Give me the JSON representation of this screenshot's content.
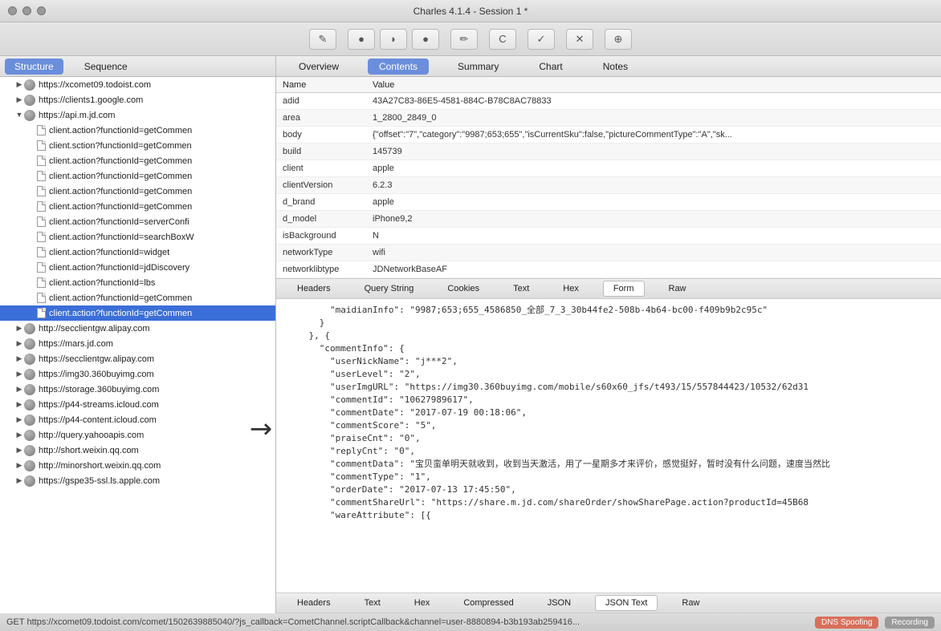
{
  "window": {
    "title": "Charles 4.1.4 - Session 1 *"
  },
  "toolbar_icons": [
    "✎",
    "●",
    "◗",
    "●",
    "✏",
    "C",
    "✓",
    "✕",
    "⊕"
  ],
  "left_tabs": [
    {
      "label": "Structure",
      "active": true
    },
    {
      "label": "Sequence",
      "active": false
    }
  ],
  "tree": [
    {
      "type": "host",
      "label": "https://xcomet09.todoist.com",
      "expand": "closed"
    },
    {
      "type": "host",
      "label": "https://clients1.google.com",
      "expand": "closed"
    },
    {
      "type": "host",
      "label": "https://api.m.jd.com",
      "expand": "open",
      "children": [
        {
          "label": "client.action?functionId=getCommen"
        },
        {
          "label": "client.sction?functionId=getCommen"
        },
        {
          "label": "client.action?functionId=getCommen"
        },
        {
          "label": "client.action?functionId=getCommen"
        },
        {
          "label": "client.action?functionId=getCommen"
        },
        {
          "label": "client.action?functionId=getCommen"
        },
        {
          "label": "client.action?functionId=serverConfi"
        },
        {
          "label": "client.action?functionId=searchBoxW"
        },
        {
          "label": "client.action?functionId=widget"
        },
        {
          "label": "client.action?functionId=jdDiscovery"
        },
        {
          "label": "client.action?functionId=lbs"
        },
        {
          "label": "client.action?functionId=getCommen"
        },
        {
          "label": "client.action?functionId=getCommen",
          "selected": true
        }
      ]
    },
    {
      "type": "host",
      "label": "http://secclientgw.alipay.com",
      "expand": "closed"
    },
    {
      "type": "host",
      "label": "https://mars.jd.com",
      "expand": "closed"
    },
    {
      "type": "host",
      "label": "https://secclientgw.alipay.com",
      "expand": "closed"
    },
    {
      "type": "host",
      "label": "https://img30.360buyimg.com",
      "expand": "closed"
    },
    {
      "type": "host",
      "label": "https://storage.360buyimg.com",
      "expand": "closed"
    },
    {
      "type": "host",
      "label": "https://p44-streams.icloud.com",
      "expand": "closed"
    },
    {
      "type": "host",
      "label": "https://p44-content.icloud.com",
      "expand": "closed"
    },
    {
      "type": "host",
      "label": "http://query.yahooapis.com",
      "expand": "closed"
    },
    {
      "type": "host",
      "label": "http://short.weixin.qq.com",
      "expand": "closed"
    },
    {
      "type": "host",
      "label": "http://minorshort.weixin.qq.com",
      "expand": "closed"
    },
    {
      "type": "host",
      "label": "https://gspe35-ssl.ls.apple.com",
      "expand": "closed"
    }
  ],
  "right_tabs": [
    "Overview",
    "Contents",
    "Summary",
    "Chart",
    "Notes"
  ],
  "right_active": 1,
  "kv_header": {
    "name": "Name",
    "value": "Value"
  },
  "params": [
    {
      "k": "adid",
      "v": "43A27C83-86E5-4581-884C-B78C8AC78833"
    },
    {
      "k": "area",
      "v": "1_2800_2849_0"
    },
    {
      "k": "body",
      "v": "{\"offset\":\"7\",\"category\":\"9987;653;655\",\"isCurrentSku\":false,\"pictureCommentType\":\"A\",\"sk..."
    },
    {
      "k": "build",
      "v": "145739"
    },
    {
      "k": "client",
      "v": "apple"
    },
    {
      "k": "clientVersion",
      "v": "6.2.3"
    },
    {
      "k": "d_brand",
      "v": "apple"
    },
    {
      "k": "d_model",
      "v": "iPhone9,2"
    },
    {
      "k": "isBackground",
      "v": "N"
    },
    {
      "k": "networkType",
      "v": "wifi"
    },
    {
      "k": "networklibtype",
      "v": "JDNetworkBaseAF"
    }
  ],
  "req_tabs": [
    "Headers",
    "Query String",
    "Cookies",
    "Text",
    "Hex",
    "Form",
    "Raw"
  ],
  "req_active": 5,
  "json_lines": [
    "        \"maidianInfo\": \"9987;653;655_4586850_全部_7_3_30b44fe2-508b-4b64-bc00-f409b9b2c95c\"",
    "      }",
    "    }, {",
    "      \"commentInfo\": {",
    "        \"userNickName\": \"j***2\",",
    "        \"userLevel\": \"2\",",
    "        \"userImgURL\": \"https://img30.360buyimg.com/mobile/s60x60_jfs/t493/15/557844423/10532/62d31",
    "        \"commentId\": \"10627989617\",",
    "        \"commentDate\": \"2017-07-19 00:18:06\",",
    "        \"commentScore\": \"5\",",
    "        \"praiseCnt\": \"0\",",
    "        \"replyCnt\": \"0\",",
    "        \"commentData\": \"宝贝蛮单明天就收到，收到当天激活，用了一星期多才来评价，感觉挺好，暂时没有什么问题，速度当然比",
    "        \"commentType\": \"1\",",
    "        \"orderDate\": \"2017-07-13 17:45:50\",",
    "        \"commentShareUrl\": \"https://share.m.jd.com/shareOrder/showSharePage.action?productId=45B68",
    "        \"wareAttribute\": [{"
  ],
  "resp_tabs": [
    "Headers",
    "Text",
    "Hex",
    "Compressed",
    "JSON",
    "JSON Text",
    "Raw"
  ],
  "resp_active": 5,
  "status": {
    "msg": "GET https://xcomet09.todoist.com/comet/1502639885040/?js_callback=CometChannel.scriptCallback&channel=user-8880894-b3b193ab259416...",
    "dns": "DNS Spoofing",
    "rec": "Recording"
  }
}
